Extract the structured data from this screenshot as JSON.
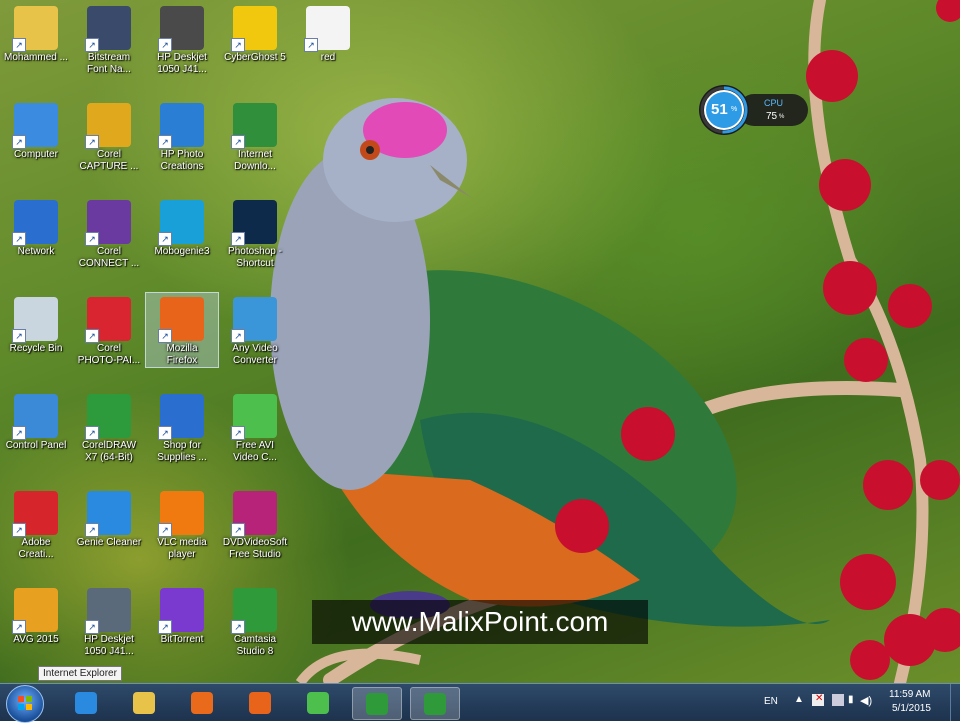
{
  "desktop": {
    "icons": [
      {
        "label": "Mohammed ...",
        "icon": "user-folder-icon"
      },
      {
        "label": "Bitstream\nFont Na...",
        "icon": "bitstream-font-navigator-icon"
      },
      {
        "label": "HP Deskjet\n1050 J41...",
        "icon": "printer-icon"
      },
      {
        "label": "CyberGhost 5",
        "icon": "cyberghost-icon"
      },
      {
        "label": "red",
        "icon": "spreadsheet-file-icon"
      },
      {
        "label": "Computer",
        "icon": "computer-icon"
      },
      {
        "label": "Corel\nCAPTURE ...",
        "icon": "corel-capture-icon"
      },
      {
        "label": "HP Photo\nCreations",
        "icon": "hp-photo-creations-icon"
      },
      {
        "label": "Internet\nDownlo...",
        "icon": "internet-download-manager-icon"
      },
      {
        "label": "Network",
        "icon": "network-icon"
      },
      {
        "label": "Corel\nCONNECT ...",
        "icon": "corel-connect-icon"
      },
      {
        "label": "Mobogenie3",
        "icon": "mobogenie-icon"
      },
      {
        "label": "Photoshop -\nShortcut",
        "icon": "photoshop-icon"
      },
      {
        "label": "Recycle Bin",
        "icon": "recycle-bin-icon"
      },
      {
        "label": "Corel\nPHOTO-PAI...",
        "icon": "corel-photo-paint-icon"
      },
      {
        "label": "Mozilla\nFirefox",
        "icon": "firefox-icon"
      },
      {
        "label": "Any Video\nConverter",
        "icon": "any-video-converter-icon"
      },
      {
        "label": "Control Panel",
        "icon": "control-panel-icon"
      },
      {
        "label": "CorelDRAW\nX7 (64-Bit)",
        "icon": "coreldraw-icon"
      },
      {
        "label": "Shop for\nSupplies ...",
        "icon": "shop-supplies-icon"
      },
      {
        "label": "Free AVI\nVideo C...",
        "icon": "free-avi-video-converter-icon"
      },
      {
        "label": "Adobe\nCreati...",
        "icon": "adobe-creative-cloud-icon"
      },
      {
        "label": "Genie Cleaner",
        "icon": "genie-cleaner-icon"
      },
      {
        "label": "VLC media\nplayer",
        "icon": "vlc-icon"
      },
      {
        "label": "DVDVideoSoft\nFree Studio",
        "icon": "dvdvideosoft-icon"
      },
      {
        "label": "AVG 2015",
        "icon": "avg-icon"
      },
      {
        "label": "HP Deskjet\n1050 J41...",
        "icon": "scanner-icon"
      },
      {
        "label": "BitTorrent",
        "icon": "bittorrent-icon"
      },
      {
        "label": "Camtasia\nStudio 8",
        "icon": "camtasia-icon"
      }
    ],
    "icon_colors": {
      "user-folder-icon": "#e8c34a",
      "bitstream-font-navigator-icon": "#3a4a6a",
      "printer-icon": "#4a4a4a",
      "cyberghost-icon": "#f2c80f",
      "spreadsheet-file-icon": "#f4f4f4",
      "computer-icon": "#3b8be0",
      "corel-capture-icon": "#e0a81c",
      "hp-photo-creations-icon": "#2a7fd4",
      "internet-download-manager-icon": "#2f8f3a",
      "network-icon": "#2a6fd0",
      "corel-connect-icon": "#6a3aa0",
      "mobogenie-icon": "#1aa0d8",
      "photoshop-icon": "#0d2a4a",
      "recycle-bin-icon": "#c9d6e0",
      "corel-photo-paint-icon": "#d8252f",
      "firefox-icon": "#e8641a",
      "any-video-converter-icon": "#3a96d8",
      "control-panel-icon": "#3a8ad8",
      "coreldraw-icon": "#2d9a3c",
      "shop-supplies-icon": "#2a6fd0",
      "free-avi-video-converter-icon": "#4cbf4c",
      "adobe-creative-cloud-icon": "#d7262b",
      "genie-cleaner-icon": "#2a8ae0",
      "vlc-icon": "#f07a10",
      "dvdvideosoft-icon": "#b8237a",
      "avg-icon": "#e8a020",
      "scanner-icon": "#5a6a7a",
      "bittorrent-icon": "#7a3ad0",
      "camtasia-icon": "#2e9a3a"
    },
    "selected_icon": "Mozilla\nFirefox"
  },
  "cpu_widget": {
    "percent": "51",
    "percent_sign": "%",
    "label": "CPU",
    "value": "75",
    "value_sign": "%",
    "ring_fraction": 0.51,
    "ring_color": "#2e9be6"
  },
  "watermark": {
    "text": "www.MalixPoint.com"
  },
  "tooltip": {
    "text": "Internet Explorer"
  },
  "taskbar": {
    "buttons": [
      {
        "icon": "internet-explorer-icon",
        "active": false,
        "color": "#2a8ae0"
      },
      {
        "icon": "file-explorer-icon",
        "active": false,
        "color": "#e8c34a"
      },
      {
        "icon": "media-player-icon",
        "active": false,
        "color": "#e86a1a"
      },
      {
        "icon": "firefox-icon",
        "active": false,
        "color": "#e8641a"
      },
      {
        "icon": "free-avi-video-converter-icon",
        "active": false,
        "color": "#4cbf4c"
      },
      {
        "icon": "camtasia-recorder-icon",
        "active": true,
        "color": "#2e9a3a"
      },
      {
        "icon": "camtasia-studio-icon",
        "active": true,
        "color": "#2e9a3a"
      }
    ],
    "tray": {
      "language": "EN",
      "time": "11:59 AM",
      "date": "5/1/2015"
    }
  },
  "colors": {
    "taskbar": "#1d324d",
    "watermark_bg": "#000000",
    "berries": "#c8102e"
  }
}
